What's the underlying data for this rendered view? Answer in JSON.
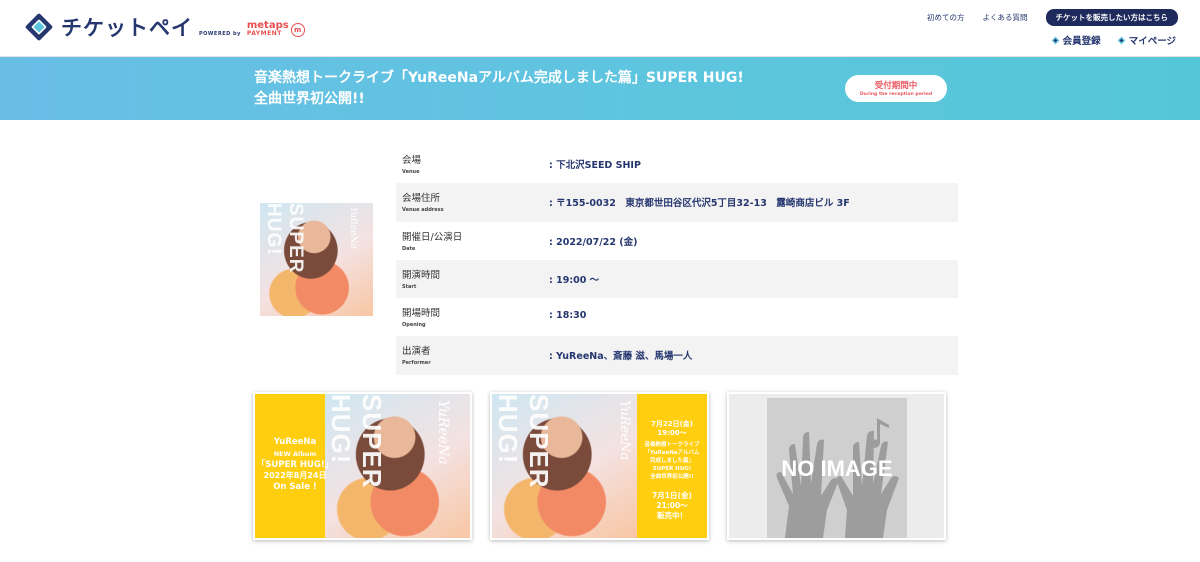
{
  "header": {
    "logo_text": "チケットペイ",
    "powered_by": "POWERED by",
    "partner_top": "metaps",
    "partner_bottom": "PAYMENT",
    "partner_badge": "m",
    "links": [
      "初めての方",
      "よくある質問"
    ],
    "seller_button": "チケットを販売したい方はこちら",
    "nav": [
      {
        "label": "会員登録",
        "icon": "diamond-icon"
      },
      {
        "label": "マイページ",
        "icon": "diamond-icon"
      }
    ]
  },
  "colors": {
    "brand_navy": "#26376f",
    "banner_start": "#69bee6",
    "banner_end": "#54c7d6",
    "status_red": "#e85a63",
    "flyer_yellow": "#ffce0f"
  },
  "event": {
    "title": "音楽熱想トークライブ「YuReeNaアルバム完成しました篇」SUPER HUG!全曲世界初公開!!",
    "status_ja": "受付期間中",
    "status_en": "During the reception period"
  },
  "details": [
    {
      "label_ja": "会場",
      "label_en": "Venue",
      "value": ": 下北沢SEED SHIP"
    },
    {
      "label_ja": "会場住所",
      "label_en": "Venue address",
      "value": ": 〒155-0032　東京都世田谷区代沢5丁目32-13　露崎商店ビル 3F"
    },
    {
      "label_ja": "開催日/公演日",
      "label_en": "Date",
      "value": ": 2022/07/22 (金)"
    },
    {
      "label_ja": "開演時間",
      "label_en": "Start",
      "value": ": 19:00 ～"
    },
    {
      "label_ja": "開場時間",
      "label_en": "Opening",
      "value": ": 18:30"
    },
    {
      "label_ja": "出演者",
      "label_en": "Performer",
      "value": ": YuReeNa、斎藤 滋、馬場一人"
    }
  ],
  "images": {
    "main_vertical_text": "SUPER HUG!",
    "main_script_text": "YuReeNa",
    "flyer1": {
      "name": "YuReeNa",
      "album": "NEW Album",
      "title": "「SUPER HUG!」",
      "date": "2022年8月24日",
      "sale": "On Sale !",
      "vertical": "SUPER HUG!",
      "script": "YuReeNa"
    },
    "flyer2": {
      "line1": "7月22日(金)",
      "line2": "19:00～",
      "line3": "音楽熱想トークライブ",
      "line4": "「YuReeNaアルバム",
      "line5": "完成しました篇」",
      "line6": "SUPER HUG!",
      "line7": "全曲世界初公開!!",
      "line8": "7月1日(金)",
      "line9": "21:00～",
      "line10": "販売中！",
      "vertical": "SUPER HUG!",
      "script": "YuReeNa"
    },
    "noimage_text": "NO IMAGE"
  }
}
